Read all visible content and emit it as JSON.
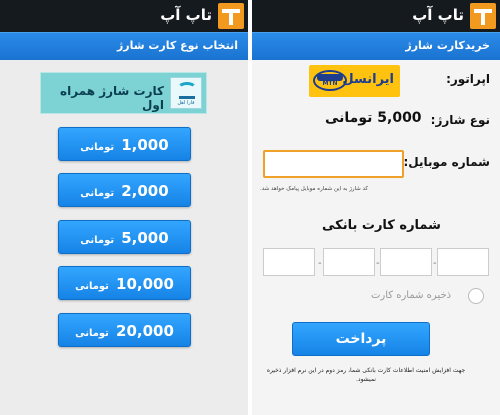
{
  "app": {
    "title": "تاپ آپ"
  },
  "left": {
    "subtitle": "انتخاب نوع کارت شارژ",
    "banner": {
      "text": "کارت شارژ همراه اول",
      "logo_small_text": "فارا اهل"
    },
    "amounts": [
      {
        "value": "1,000",
        "unit": "تومانی"
      },
      {
        "value": "2,000",
        "unit": "تومانی"
      },
      {
        "value": "5,000",
        "unit": "تومانی"
      },
      {
        "value": "10,000",
        "unit": "تومانی"
      },
      {
        "value": "20,000",
        "unit": "تومانی"
      }
    ]
  },
  "right": {
    "subtitle": "خریدکارت شارژ",
    "operator_label": "اپراتور:",
    "operator_name": "ایرانسل",
    "operator_logo_text": "MTN",
    "operator_logo_top": "ایرانسل",
    "charge_type_label": "نوع شارژ:",
    "charge_type_value": "5,000 تومانی",
    "mobile_label": "شماره موبایل:",
    "mobile_value": "",
    "mobile_hint": "کد شارژ به این شماره موبایل پیامک خواهد شد.",
    "card_title": "شماره کارت بانکی",
    "card_separator": "-",
    "save_card_label": "ذخیره شماره کارت",
    "pay_button": "پرداخت",
    "security_note": "جهت افزایش امنیت اطلاعات کارت بانکی شما، رمز دوم در این نرم افزار ذخیره نمیشود."
  }
}
